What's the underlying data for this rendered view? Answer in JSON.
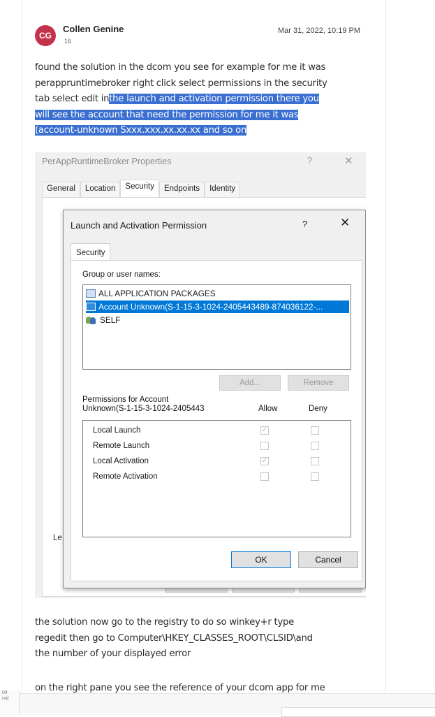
{
  "post": {
    "avatar_initials": "CG",
    "author": "Collen Genine",
    "author_count": "16",
    "date": "Mar 31, 2022, 10:19 PM",
    "text_line1": "found the solution in the dcom you see for example for me it was",
    "text_line2": "perappruntimebroker right click select permissions in the security",
    "text_line3_plain": "tab select edit in",
    "text_line3_hl": "the launch and activation permission there you",
    "text_line4_hl": "will see the account that need the permission for me it was",
    "text_line5_hl": "(account-unknown Sxxx.xxx.xx.xx.xx and so on",
    "text2_line1": "the solution now go to the registry to do so winkey+r type",
    "text2_line2": "regedit then go to Computer\\HKEY_CLASSES_ROOT\\CLSID\\and",
    "text2_line3": "the number of your displayed error",
    "text3_line1": "on the right pane you see the reference of your dcom app for me"
  },
  "outer_dialog": {
    "title": "PerAppRuntimeBroker Properties",
    "help": "?",
    "close": "✕",
    "tabs": [
      "General",
      "Location",
      "Security",
      "Endpoints",
      "Identity"
    ],
    "active_tab": "Security",
    "partial_label": "Le"
  },
  "inner_dialog": {
    "title": "Launch and Activation Permission",
    "help": "?",
    "close": "✕",
    "tab": "Security",
    "group_label": "Group or user names:",
    "groups": [
      "ALL APPLICATION PACKAGES",
      "Account Unknown(S-1-15-3-1024-2405443489-874036122-...",
      "SELF"
    ],
    "selected_group": 1,
    "add_label": "Add...",
    "remove_label": "Remove",
    "perm_label_line1": "Permissions for Account",
    "perm_label_line2": "Unknown(S-1-15-3-1024-2405443",
    "allow_label": "Allow",
    "deny_label": "Deny",
    "permissions": [
      {
        "name": "Local Launch",
        "allow": true,
        "deny": false
      },
      {
        "name": "Remote Launch",
        "allow": false,
        "deny": false
      },
      {
        "name": "Local Activation",
        "allow": true,
        "deny": false
      },
      {
        "name": "Remote Activation",
        "allow": false,
        "deny": false
      }
    ],
    "ok_label": "OK",
    "cancel_label": "Cancel"
  },
  "footer": {
    "side_text_1": "04",
    "side_text_2": "nal"
  }
}
